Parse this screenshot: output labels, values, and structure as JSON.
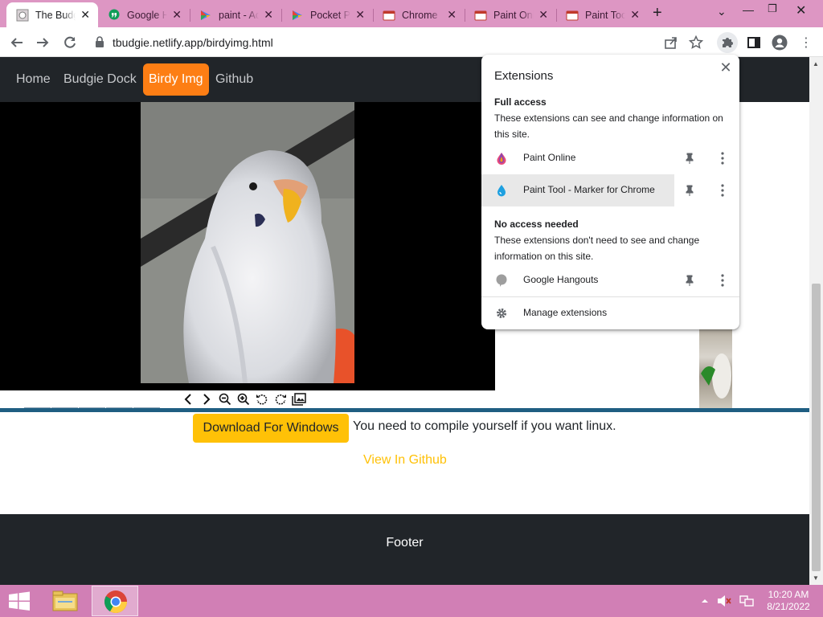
{
  "tabs": [
    {
      "title": "The Budgie",
      "active": true
    },
    {
      "title": "Google Hangouts"
    },
    {
      "title": "paint - Add"
    },
    {
      "title": "Pocket Paint"
    },
    {
      "title": "Chrome"
    },
    {
      "title": "Paint Online"
    },
    {
      "title": "Paint Tool"
    }
  ],
  "toolbar": {
    "url": "tbudgie.netlify.app/birdyimg.html"
  },
  "nav": {
    "items": [
      "Home",
      "Budgie Dock",
      "Birdy Img",
      "Github"
    ],
    "active_index": 2
  },
  "content": {
    "download_label": "Download For Windows",
    "compile_note": "You need to compile yourself if you want linux.",
    "github_link": "View In Github",
    "footer": "Footer"
  },
  "extensions": {
    "title": "Extensions",
    "full_access_heading": "Full access",
    "full_access_desc": "These extensions can see and change information on this site.",
    "full_access_items": [
      "Paint Online",
      "Paint Tool - Marker for Chrome"
    ],
    "no_access_heading": "No access needed",
    "no_access_desc": "These extensions don't need to see and change information on this site.",
    "no_access_items": [
      "Google Hangouts"
    ],
    "manage_label": "Manage extensions"
  },
  "taskbar": {
    "time": "10:20 AM",
    "date": "8/21/2022"
  },
  "colors": {
    "tabstrip": "#dd96c3",
    "navbar": "#212529",
    "active_nav": "#fd7e14",
    "download": "#ffc107",
    "taskbar": "#d17fb5"
  }
}
